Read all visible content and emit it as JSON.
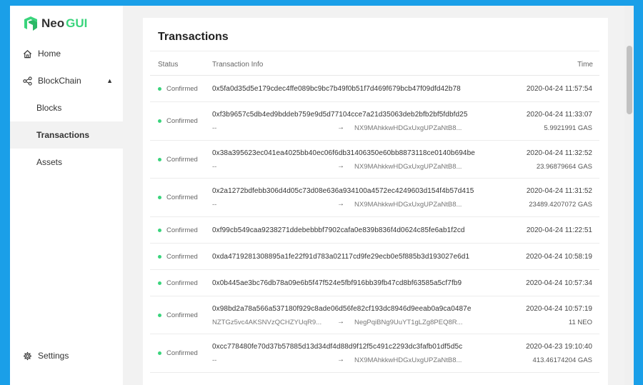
{
  "brand": {
    "neo": "Neo",
    "gui": "GUI"
  },
  "sidebar": {
    "items": [
      {
        "label": "Home"
      },
      {
        "label": "BlockChain"
      },
      {
        "label": "Blocks"
      },
      {
        "label": "Transactions"
      },
      {
        "label": "Assets"
      }
    ],
    "settings": "Settings"
  },
  "page": {
    "title": "Transactions",
    "columns": {
      "status": "Status",
      "info": "Transaction Info",
      "time": "Time"
    }
  },
  "transactions": [
    {
      "status": "Confirmed",
      "hash": "0x5fa0d35d5e179cdec4ffe089bc9bc7b49f0b51f7d469f679bcb47f09dfd42b78",
      "time": "2020-04-24 11:57:54",
      "from": "",
      "to": "",
      "amount": ""
    },
    {
      "status": "Confirmed",
      "hash": "0xf3b9657c5db4ed9bddeb759e9d5d77104cce7a21d35063deb2bfb2bf5fdbfd25",
      "time": "2020-04-24 11:33:07",
      "from": "--",
      "to": "NX9MAhkkwHDGxUxgUPZaNtB8...",
      "amount": "5.9921991 GAS"
    },
    {
      "status": "Confirmed",
      "hash": "0x38a395623ec041ea4025bb40ec06f6db31406350e60bb8873118ce0140b694be",
      "time": "2020-04-24 11:32:52",
      "from": "--",
      "to": "NX9MAhkkwHDGxUxgUPZaNtB8...",
      "amount": "23.96879664 GAS"
    },
    {
      "status": "Confirmed",
      "hash": "0x2a1272bdfebb306d4d05c73d08e636a934100a4572ec4249603d154f4b57d415",
      "time": "2020-04-24 11:31:52",
      "from": "--",
      "to": "NX9MAhkkwHDGxUxgUPZaNtB8...",
      "amount": "23489.4207072 GAS"
    },
    {
      "status": "Confirmed",
      "hash": "0xf99cb549caa9238271ddebebbbf7902cafa0e839b836f4d0624c85fe6ab1f2cd",
      "time": "2020-04-24 11:22:51",
      "from": "",
      "to": "",
      "amount": ""
    },
    {
      "status": "Confirmed",
      "hash": "0xda4719281308895a1fe22f91d783a02117cd9fe29ecb0e5f885b3d193027e6d1",
      "time": "2020-04-24 10:58:19",
      "from": "",
      "to": "",
      "amount": ""
    },
    {
      "status": "Confirmed",
      "hash": "0x0b445ae3bc76db78a09e6b5f47f524e5fbf916bb39fb47cd8bf63585a5cf7fb9",
      "time": "2020-04-24 10:57:34",
      "from": "",
      "to": "",
      "amount": ""
    },
    {
      "status": "Confirmed",
      "hash": "0x98bd2a78a566a537180f929c8ade06d56fe82cf193dc8946d9eeab0a9ca0487e",
      "time": "2020-04-24 10:57:19",
      "from": "NZTGz5vc4AKSNVzQCHZYUqR9...",
      "to": "NegPqiBNg9UuYT1gLZg8PEQ8R...",
      "amount": "11 NEO"
    },
    {
      "status": "Confirmed",
      "hash": "0xcc778480fe70d37b57885d13d34df4d88d9f12f5c491c2293dc3fafb01df5d5c",
      "time": "2020-04-23 19:10:40",
      "from": "--",
      "to": "NX9MAhkkwHDGxUxgUPZaNtB8...",
      "amount": "413.46174204 GAS"
    }
  ],
  "icons": {
    "home": "home-icon",
    "blockchain": "share-nodes-icon",
    "settings": "gear-icon",
    "arrow": "arrow-right-icon"
  },
  "colors": {
    "frame": "#1a9fe8",
    "accent": "#3ad47c",
    "status_confirmed": "#3ad47c"
  }
}
